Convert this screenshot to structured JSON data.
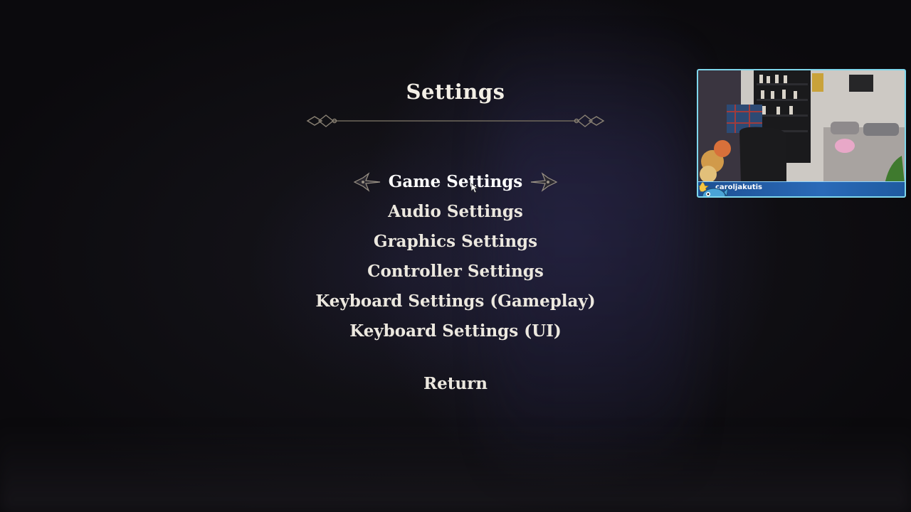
{
  "screen": {
    "title": "Settings"
  },
  "menu": {
    "items": [
      {
        "label": "Game Settings",
        "selected": true
      },
      {
        "label": "Audio Settings",
        "selected": false
      },
      {
        "label": "Graphics Settings",
        "selected": false
      },
      {
        "label": "Controller Settings",
        "selected": false
      },
      {
        "label": "Keyboard Settings (Gameplay)",
        "selected": false
      },
      {
        "label": "Keyboard Settings (UI)",
        "selected": false
      }
    ],
    "return_label": "Return"
  },
  "webcam_overlay": {
    "username": "caroljakutis",
    "icons": [
      "star-icon",
      "drop-icon",
      "mascot-icon"
    ],
    "border_color": "#7fd7ec",
    "bar_color": "#2a6ab8"
  },
  "colors": {
    "text": "#ece8df",
    "background": "#0c0b0f",
    "ornament": "#8a8274"
  },
  "icons": {
    "divider": "ornamental-divider-icon",
    "flourish_left": "flourish-left-icon",
    "flourish_right": "flourish-right-icon",
    "cursor": "mouse-cursor-icon"
  }
}
